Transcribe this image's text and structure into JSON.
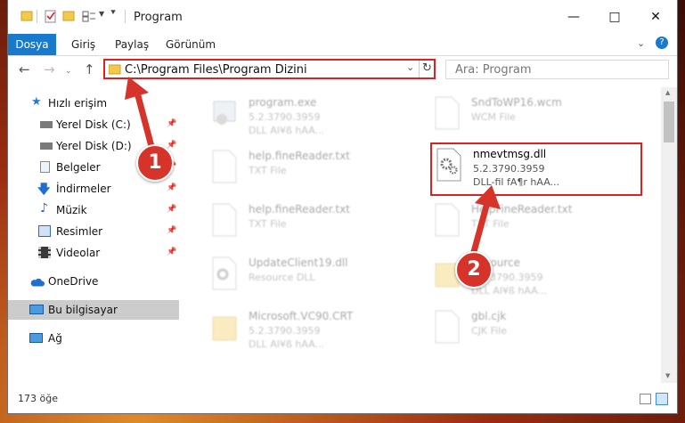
{
  "window": {
    "title": "Program",
    "quick_access_icons": [
      "folder-icon",
      "checklist-icon",
      "folder-icon",
      "properties-icon"
    ]
  },
  "ribbon": {
    "tabs": [
      "Dosya",
      "Giriş",
      "Paylaş",
      "Görünüm"
    ]
  },
  "navigation": {
    "address": "C:\\Program Files\\Program Dizini",
    "search_placeholder": "Ara: Program"
  },
  "sidebar": {
    "items": [
      {
        "label": "Hızlı erişim",
        "icon": "star-icon",
        "pinned": false
      },
      {
        "label": "Yerel Disk (C:)",
        "icon": "drive-icon",
        "pinned": true
      },
      {
        "label": "Yerel Disk (D:)",
        "icon": "drive-icon",
        "pinned": true
      },
      {
        "label": "Belgeler",
        "icon": "documents-icon",
        "pinned": true
      },
      {
        "label": "İndirmeler",
        "icon": "download-icon",
        "pinned": true
      },
      {
        "label": "Müzik",
        "icon": "music-icon",
        "pinned": true
      },
      {
        "label": "Resimler",
        "icon": "pictures-icon",
        "pinned": true
      },
      {
        "label": "Videolar",
        "icon": "video-icon",
        "pinned": true
      },
      {
        "label": "OneDrive",
        "icon": "cloud-icon",
        "pinned": false
      },
      {
        "label": "Bu bilgisayar",
        "icon": "computer-icon",
        "pinned": false
      },
      {
        "label": "Ağ",
        "icon": "network-icon",
        "pinned": false
      }
    ]
  },
  "files": [
    {
      "name": "program.exe",
      "line1": "5.2.3790.3959",
      "line2": "DLL AI¥ß hAA...",
      "icon": "exe-icon",
      "faded": true
    },
    {
      "name": "SndToWP16.wcm",
      "line1": "WCM File",
      "line2": "",
      "icon": "file-icon",
      "faded": true
    },
    {
      "name": "help.fineReader.txt",
      "line1": "TXT File",
      "line2": "",
      "icon": "file-icon",
      "faded": true
    },
    {
      "name": "nmevtmsg.dll",
      "line1": "5.2.3790.3959",
      "line2": "DLL-fil fA¶r hAA...",
      "icon": "dll-gear-icon",
      "faded": false
    },
    {
      "name": "help.fineReader.txt",
      "line1": "TXT File",
      "line2": "",
      "icon": "file-icon",
      "faded": true
    },
    {
      "name": "HelpFineReader.txt",
      "line1": "TXT File",
      "line2": "",
      "icon": "file-icon",
      "faded": true
    },
    {
      "name": "UpdateClient19.dll",
      "line1": "Resource DLL",
      "line2": "",
      "icon": "dll-gear-icon",
      "faded": true
    },
    {
      "name": "Resource",
      "line1": "5.2.3790.3959",
      "line2": "DLL AI¥ß hAA...",
      "icon": "folder-icon",
      "faded": true
    },
    {
      "name": "Microsoft.VC90.CRT",
      "line1": "5.2.3790.3959",
      "line2": "DLL AI¥ß hAA...",
      "icon": "folder-icon",
      "faded": true
    },
    {
      "name": "gbl.cjk",
      "line1": "CJK File",
      "line2": "",
      "icon": "file-icon",
      "faded": true
    }
  ],
  "status": {
    "count": "173 öğe"
  },
  "callouts": [
    "1",
    "2"
  ],
  "colors": {
    "accent": "#1979ca",
    "highlight": "#e02020",
    "callout": "#d6342a"
  }
}
